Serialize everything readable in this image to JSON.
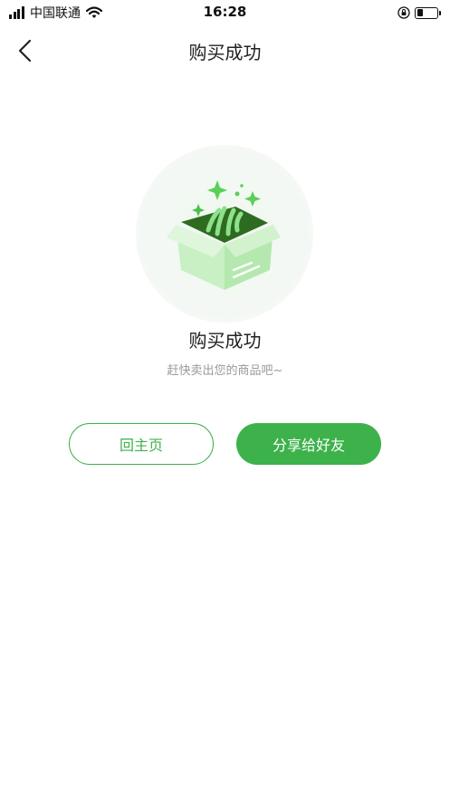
{
  "status_bar": {
    "carrier": "中国联通",
    "time": "16:28",
    "battery_level": 0.3
  },
  "nav": {
    "title": "购买成功",
    "back_icon": "chevron-left-icon"
  },
  "illustration": {
    "icon": "open-gift-box-icon",
    "accent_color": "#3db24b"
  },
  "result": {
    "title": "购买成功",
    "subtitle": "赶快卖出您的商品吧~"
  },
  "actions": {
    "home_label": "回主页",
    "share_label": "分享给好友"
  },
  "colors": {
    "primary": "#3db24b",
    "subtitle": "#999999"
  }
}
